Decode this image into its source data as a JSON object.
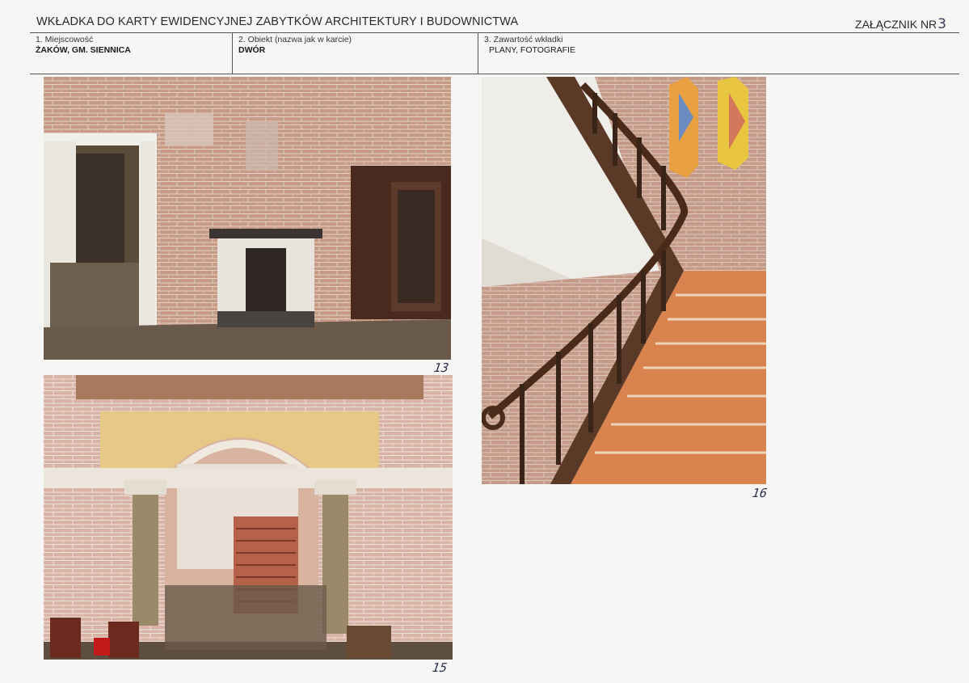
{
  "header": {
    "title": "WKŁADKA DO KARTY EWIDENCYJNEJ ZABYTKÓW ARCHITEKTURY I BUDOWNICTWA",
    "annex_label": "ZAŁĄCZNIK NR",
    "annex_number": "3"
  },
  "fields": [
    {
      "label": "1. Miejscowość",
      "value": "ŻAKÓW, GM. SIENNICA"
    },
    {
      "label": "2. Obiekt (nazwa jak w karcie)",
      "value": "DWÓR"
    },
    {
      "label": "3. Zawartość wkładki",
      "value": "PLANY, FOTOGRAFIE"
    }
  ],
  "photos": [
    {
      "number": "13",
      "subject": "fireplace-room"
    },
    {
      "number": "15",
      "subject": "hall-with-arch-and-columns"
    },
    {
      "number": "16",
      "subject": "staircase-with-stained-glass"
    }
  ]
}
